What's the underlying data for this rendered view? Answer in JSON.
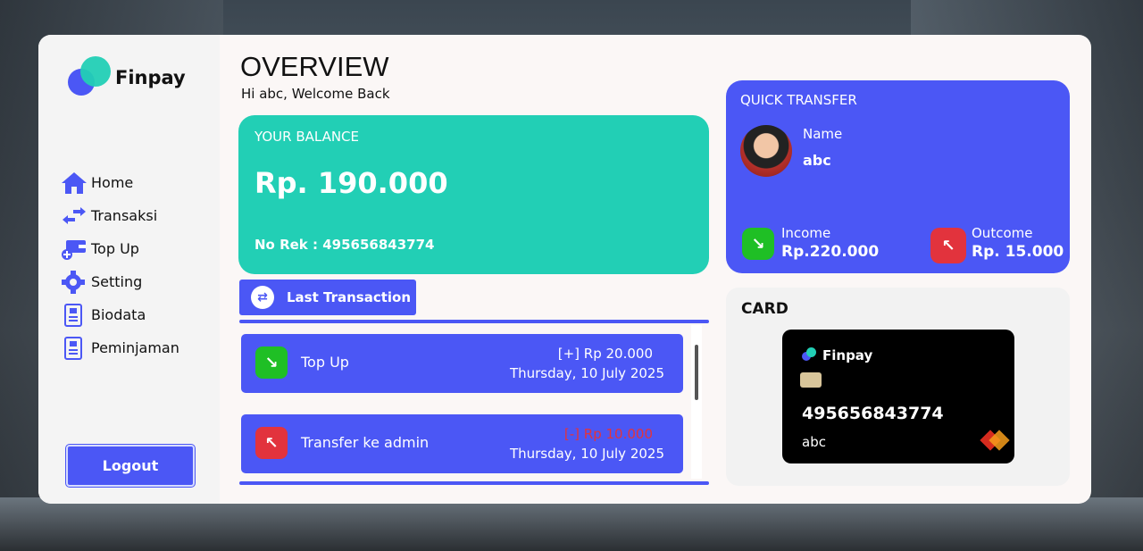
{
  "app": {
    "brand": "Finpay"
  },
  "sidebar": {
    "items": [
      {
        "label": "Home",
        "icon": "home-icon"
      },
      {
        "label": "Transaksi",
        "icon": "exchange-icon"
      },
      {
        "label": "Top Up",
        "icon": "topup-icon"
      },
      {
        "label": "Setting",
        "icon": "gear-icon"
      },
      {
        "label": "Biodata",
        "icon": "document-icon"
      },
      {
        "label": "Peminjaman",
        "icon": "document-icon"
      }
    ],
    "logout_label": "Logout"
  },
  "header": {
    "title": "OVERVIEW",
    "welcome": "Hi abc, Welcome Back"
  },
  "balance": {
    "label": "YOUR BALANCE",
    "amount": "Rp. 190.000",
    "account": "No Rek : 495656843774"
  },
  "transactions": {
    "button_label": "Last Transaction",
    "items": [
      {
        "name": "Top Up",
        "amount": "[+] Rp 20.000",
        "date": "Thursday, 10 July 2025",
        "type": "in"
      },
      {
        "name": "Transfer ke admin",
        "amount": "[-] Rp 10.000",
        "date": "Thursday, 10 July 2025",
        "type": "out"
      }
    ]
  },
  "quick_transfer": {
    "label": "QUICK TRANSFER",
    "name_label": "Name",
    "name_value": "abc",
    "income_label": "Income",
    "income_value": "Rp.220.000",
    "outcome_label": "Outcome",
    "outcome_value": "Rp. 15.000"
  },
  "card": {
    "label": "CARD",
    "brand": "Finpay",
    "number": "495656843774",
    "holder": "abc"
  },
  "colors": {
    "primary": "#4b57f5",
    "teal": "#22cfb5",
    "green": "#1fbf25",
    "red": "#e2333d"
  }
}
